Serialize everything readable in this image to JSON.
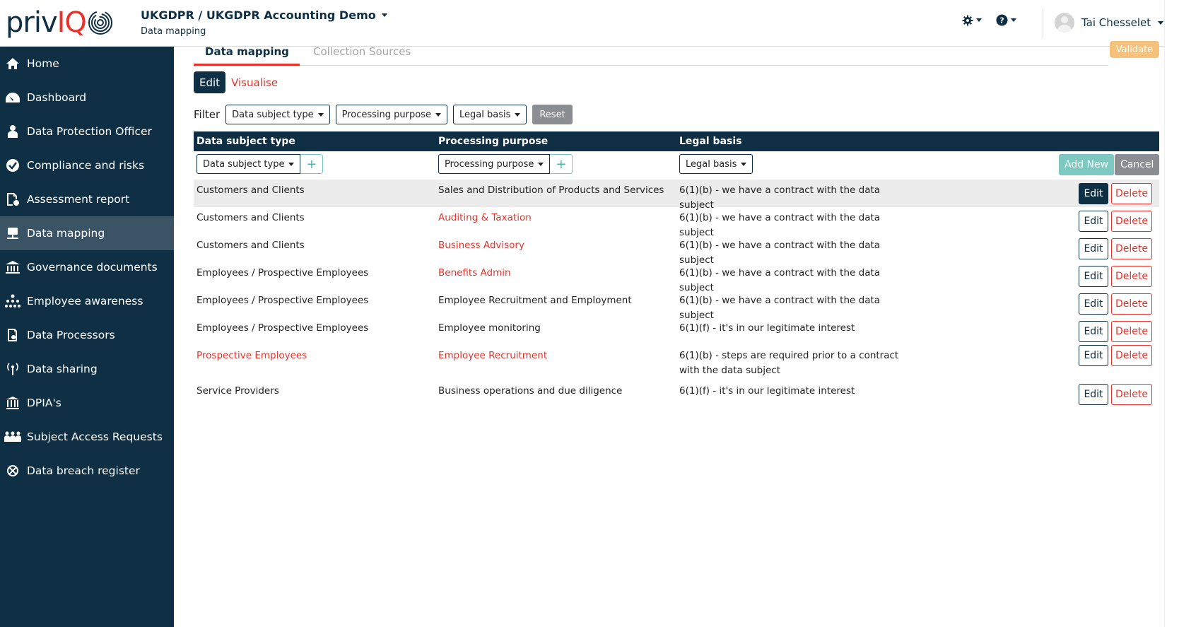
{
  "header": {
    "logo_text_a": "priv",
    "logo_text_b": "IQ",
    "project_title": "UKGDPR / UKGDPR Accounting Demo",
    "project_subtitle": "Data mapping",
    "user_name": "Tai Chesselet",
    "icons": [
      "gear-icon",
      "help-icon"
    ]
  },
  "sidebar": {
    "items": [
      {
        "label": "Home",
        "icon": "home-icon"
      },
      {
        "label": "Dashboard",
        "icon": "dashboard-icon"
      },
      {
        "label": "Data Protection Officer",
        "icon": "person-icon"
      },
      {
        "label": "Compliance and risks",
        "icon": "check-circle-icon"
      },
      {
        "label": "Assessment report",
        "icon": "report-icon"
      },
      {
        "label": "Data mapping",
        "icon": "data-mapping-icon",
        "active": true
      },
      {
        "label": "Governance documents",
        "icon": "institution-icon"
      },
      {
        "label": "Employee awareness",
        "icon": "org-chart-icon"
      },
      {
        "label": "Data Processors",
        "icon": "processor-icon"
      },
      {
        "label": "Data sharing",
        "icon": "broadcast-icon"
      },
      {
        "label": "DPIA's",
        "icon": "dpia-icon"
      },
      {
        "label": "Subject Access Requests",
        "icon": "people-icon"
      },
      {
        "label": "Data breach register",
        "icon": "breach-icon"
      }
    ]
  },
  "tabs": {
    "data_mapping": "Data mapping",
    "collection_sources": "Collection Sources",
    "validate": "Validate"
  },
  "mode": {
    "edit": "Edit",
    "visualise": "Visualise"
  },
  "filters": {
    "label": "Filter",
    "subject_type": "Data subject type",
    "purpose": "Processing purpose",
    "legal_basis": "Legal basis",
    "reset": "Reset"
  },
  "table": {
    "headers": [
      "Data subject type",
      "Processing purpose",
      "Legal basis"
    ],
    "new_row": {
      "subject_type": "Data subject type",
      "purpose": "Processing purpose",
      "legal_basis": "Legal basis",
      "add_new": "Add New",
      "cancel": "Cancel"
    },
    "edit_label": "Edit",
    "delete_label": "Delete",
    "rows": [
      {
        "subject": "Customers and Clients",
        "purpose": "Sales and Distribution of Products and Services",
        "basis": "6(1)(b) - we have a contract with the data subject"
      },
      {
        "subject": "Customers and Clients",
        "purpose": "Auditing & Taxation",
        "basis": "6(1)(b) - we have a contract with the data subject"
      },
      {
        "subject": "Customers and Clients",
        "purpose": "Business Advisory",
        "basis": "6(1)(b) - we have a contract with the data subject"
      },
      {
        "subject": "Employees / Prospective Employees",
        "purpose": "Benefits Admin",
        "basis": "6(1)(b) - we have a contract with the data subject"
      },
      {
        "subject": "Employees / Prospective Employees",
        "purpose": "Employee Recruitment and Employment",
        "basis": "6(1)(b) - we have a contract with the data subject"
      },
      {
        "subject": "Employees / Prospective Employees",
        "purpose": "Employee monitoring",
        "basis": "6(1)(f) - it's in our legitimate interest"
      },
      {
        "subject": "Prospective Employees",
        "purpose": "Employee Recruitment",
        "basis": "6(1)(b) - steps are required prior to a contract with the data subject"
      },
      {
        "subject": "Service Providers",
        "purpose": "Business operations and due diligence",
        "basis": "6(1)(f) - it's in our legitimate interest"
      }
    ]
  },
  "colors": {
    "navy": "#0f2f44",
    "accent_red": "#e8322b",
    "teal": "#7dc8c1",
    "grey_button": "#8a8d91"
  }
}
